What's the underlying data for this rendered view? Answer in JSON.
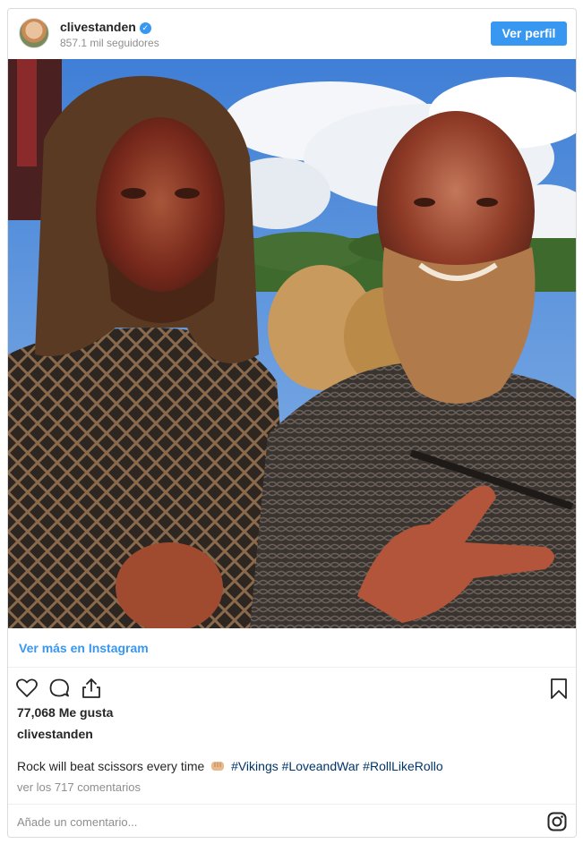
{
  "header": {
    "username": "clivestanden",
    "verified_mark": "✓",
    "followers": "857.1 mil seguidores",
    "profile_button": "Ver perfil"
  },
  "photo": {
    "alt": "Two actors in Viking costume with stage blood, outdoors under a blue sky"
  },
  "view_more": "Ver más en Instagram",
  "actions": {
    "icons": [
      "heart-icon",
      "comment-icon",
      "share-icon",
      "bookmark-icon"
    ]
  },
  "likes": "77,068 Me gusta",
  "owner": "clivestanden",
  "caption": {
    "text": "Rock will beat scissors every time",
    "emoji": "fist-emoji",
    "hashtags": [
      "#Vikings",
      "#LoveandWar",
      "#RollLikeRollo"
    ]
  },
  "comments_link": "ver los 717 comentarios",
  "comment_box": {
    "placeholder": "Añade un comentario..."
  },
  "colors": {
    "accent": "#3897f0",
    "hashtag": "#003569",
    "muted": "#8e8e8e",
    "border": "#dbdbdb"
  }
}
